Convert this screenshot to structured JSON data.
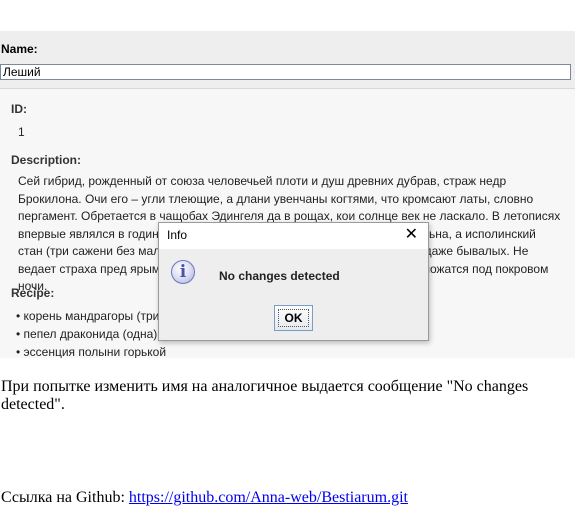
{
  "form": {
    "name_label": "Name:",
    "name_value": "Леший",
    "id_label": "ID:",
    "id_value": "1",
    "description_label": "Description:",
    "description_text": "Сей гибрид, рожденный от союза человечьей плоти и душ древних дубрав, страж недр Брокилона. Очи его – угли тлеющие, а длани увенчаны когтями, что кромсают латы, словно пергамент. Обретается в чащобах Эдингеля да в рощах, кои солнце век не ласкало. В летописях впервые являлся в годину, когда людская сталь против него была бессильна, а исполинский стан (три сажени без малого) и рык, от коего листва опадает, устрашает даже бывалых. Не ведает страха пред ярым огнем, ибо пламя ему не помеха, а силы его множатся под покровом ночи.",
    "recipe_label": "Recipe:",
    "recipe_items": [
      "корень мандрагоры (три)",
      "пепел драконида (одна)",
      "эссенция полыни горькой"
    ]
  },
  "dialog": {
    "title": "Info",
    "close_glyph": "✕",
    "message": "No changes detected",
    "ok_label": "OK",
    "icon": "info-icon"
  },
  "caption": "При попытке изменить имя на аналогичное выдается сообщение \"No changes detected\".",
  "github": {
    "prefix": "Ссылка на Github: ",
    "link_text": "https://github.com/Anna-web/Bestiarum.git"
  }
}
